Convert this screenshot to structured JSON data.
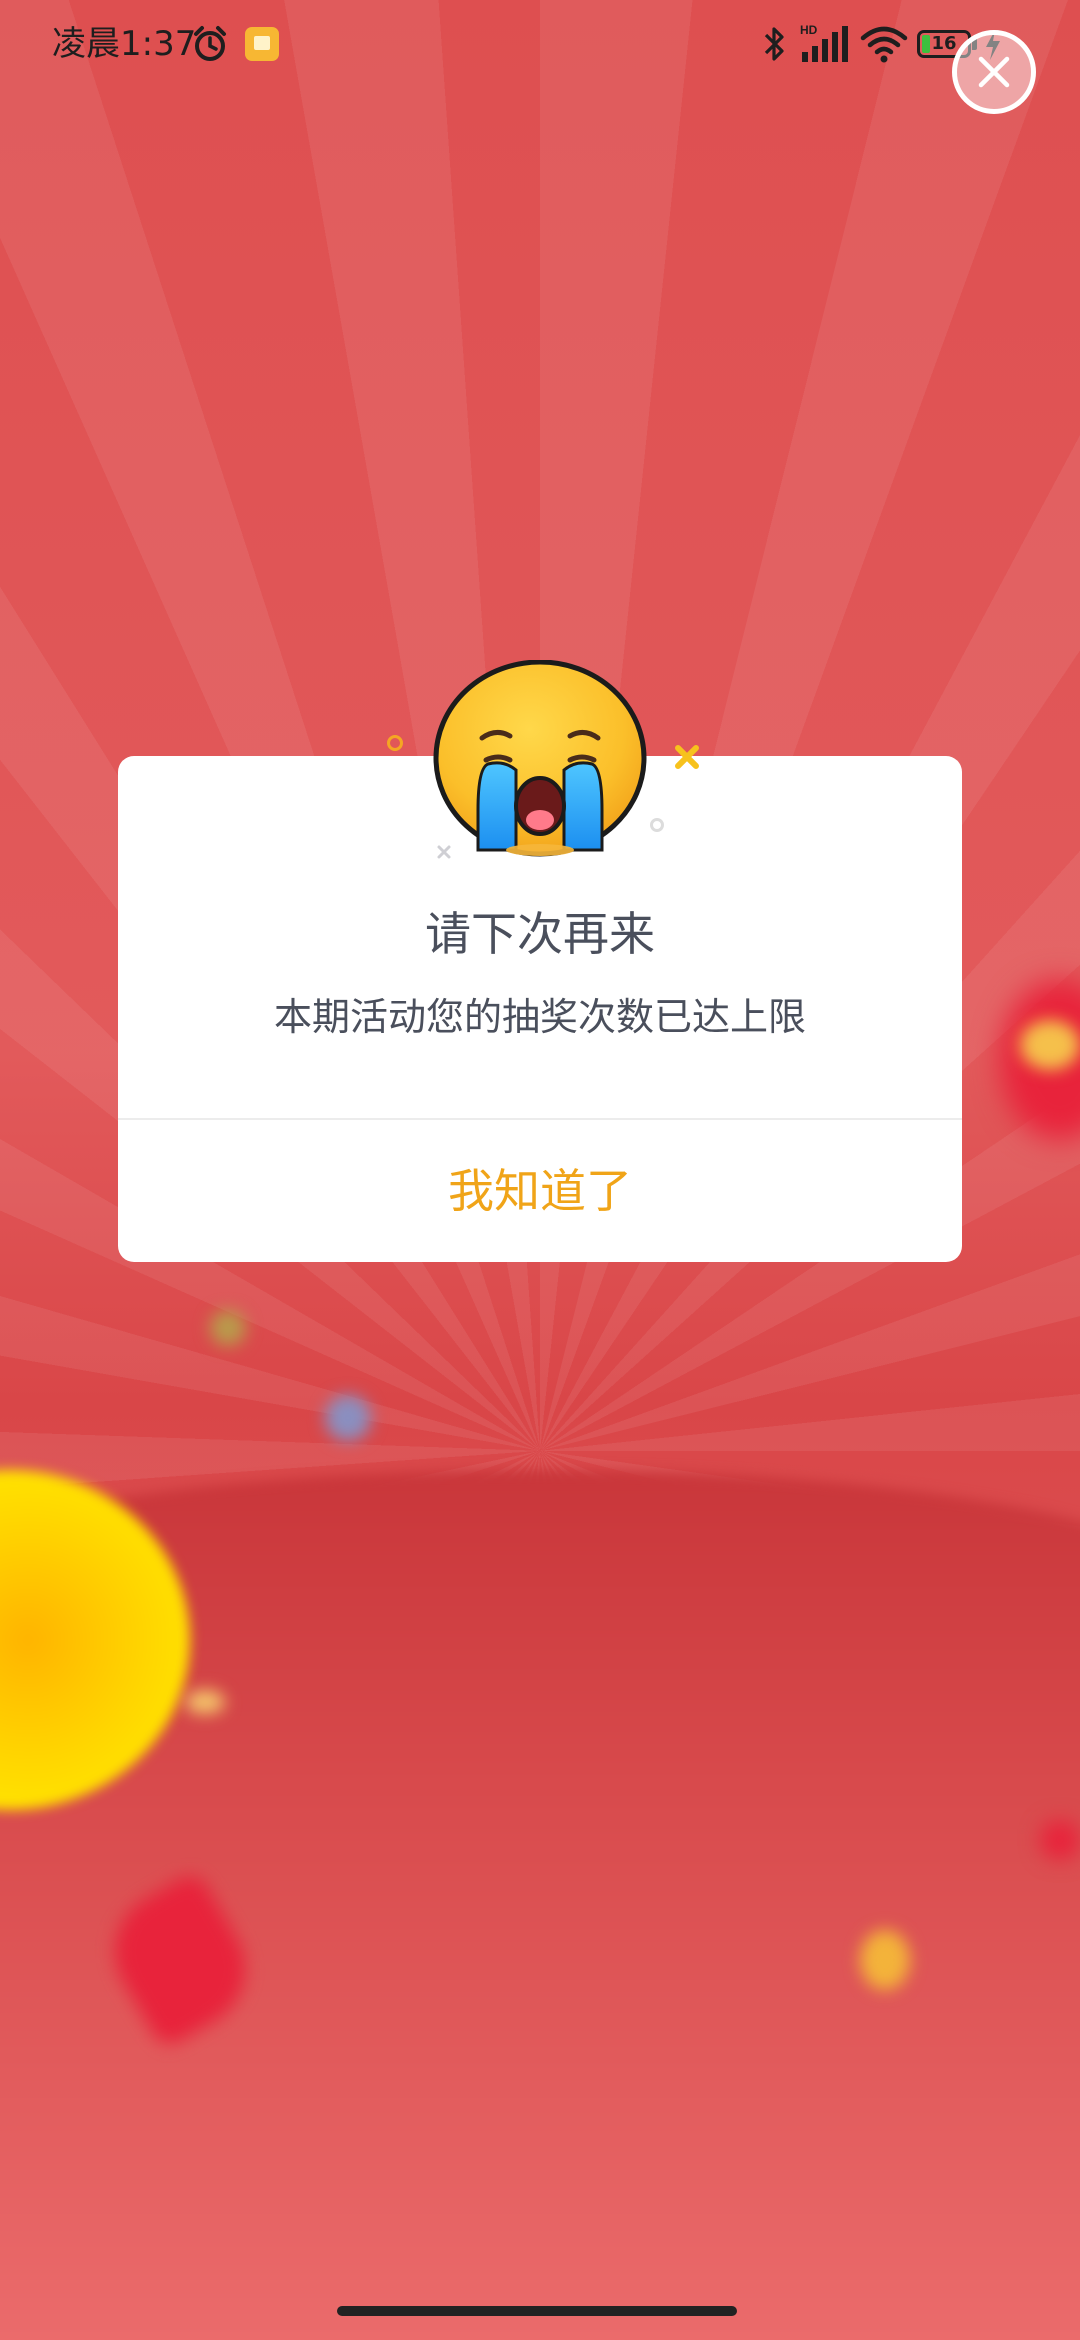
{
  "status_bar": {
    "time": "凌晨1:37",
    "battery_level": "16",
    "icons": [
      "alarm-icon",
      "notification-icon",
      "bluetooth-icon",
      "hd-signal-icon",
      "wifi-icon",
      "battery-icon",
      "charging-icon"
    ]
  },
  "dialog": {
    "title": "请下次再来",
    "message": "本期活动您的抽奖次数已达上限",
    "button_label": "我知道了",
    "icon": "crying-emoji-icon"
  },
  "close_icon": "close-icon",
  "colors": {
    "background_red": "#e05050",
    "dialog_text": "#4a4f5c",
    "button_text": "#f0a418",
    "dialog_bg": "#ffffff"
  }
}
